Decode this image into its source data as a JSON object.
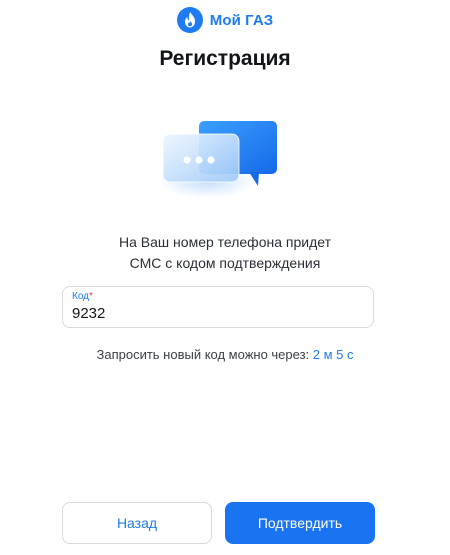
{
  "brand": {
    "name": "Мой ГАЗ",
    "logo_icon": "flame-icon",
    "color": "#1e7bf2"
  },
  "page": {
    "title": "Регистрация"
  },
  "illustration": {
    "icon": "chat-bubbles-icon"
  },
  "message": {
    "line1": "На Ваш номер телефона придет",
    "line2": "СМС с кодом подтверждения"
  },
  "code_field": {
    "label": "Код",
    "required_mark": "*",
    "value": "9232"
  },
  "resend": {
    "text": "Запросить новый код можно через: ",
    "timer": "2 м 5 с"
  },
  "buttons": {
    "back": "Назад",
    "confirm": "Подтвердить"
  },
  "colors": {
    "accent": "#1e7bf2",
    "required": "#e0413a",
    "border": "#d6dbe2"
  }
}
